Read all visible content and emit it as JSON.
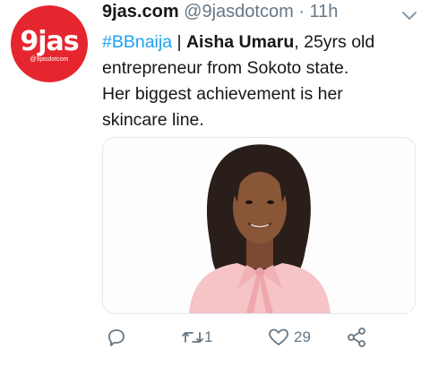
{
  "tweet": {
    "avatar": {
      "word": "9jas",
      "handle": "@9jasdotcom"
    },
    "display_name": "9jas.com",
    "handle": "@9jasdotcom",
    "separator": "·",
    "time": "11h",
    "text": {
      "hashtag": "#BBnaija",
      "pipe": " | ",
      "name": "Aisha Umaru",
      "rest_line1": ", 25yrs old",
      "line2": "entrepreneur from Sokoto state.",
      "line3": "Her biggest achievement is her",
      "line4": "skincare line."
    },
    "actions": {
      "reply_count": "",
      "retweet_count": "1",
      "like_count": "29"
    }
  },
  "colors": {
    "brand_red": "#e6262f",
    "link_blue": "#1da1f2",
    "muted_gray": "#657786",
    "text_dark": "#14171a",
    "blouse_pink": "#f6c3c6"
  },
  "icons": [
    "caret-down-icon",
    "reply-icon",
    "retweet-icon",
    "like-icon",
    "share-icon"
  ]
}
